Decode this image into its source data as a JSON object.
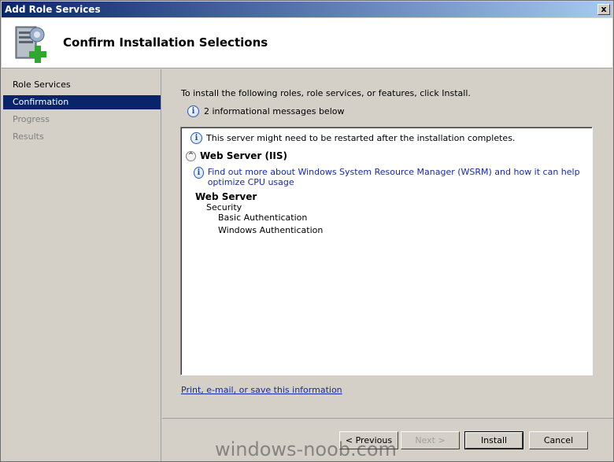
{
  "window": {
    "title": "Add Role Services",
    "close_glyph": "x"
  },
  "header": {
    "title": "Confirm Installation Selections",
    "icon": "server-add-icon"
  },
  "sidebar": {
    "items": [
      {
        "label": "Role Services",
        "state": "normal"
      },
      {
        "label": "Confirmation",
        "state": "active"
      },
      {
        "label": "Progress",
        "state": "disabled"
      },
      {
        "label": "Results",
        "state": "disabled"
      }
    ]
  },
  "content": {
    "intro": "To install the following roles, role services, or features, click Install.",
    "message_count": "2 informational messages below",
    "restart_notice": "This server might need to be restarted after the installation completes.",
    "section_title": "Web Server (IIS)",
    "wsrm_link": "Find out more about Windows System Resource Manager (WSRM) and how it can help optimize CPU usage",
    "tree": {
      "role": "Web Server",
      "group": "Security",
      "items": [
        "Basic Authentication",
        "Windows Authentication"
      ]
    },
    "print_link": "Print, e-mail, or save this information"
  },
  "buttons": {
    "previous": "< Previous",
    "next": "Next >",
    "install": "Install",
    "cancel": "Cancel"
  },
  "watermark": "windows-noob.com",
  "colors": {
    "titlebar_start": "#0a246a",
    "titlebar_end": "#a6caf0",
    "active_item": "#0a246a",
    "link": "#1a2aa0"
  }
}
